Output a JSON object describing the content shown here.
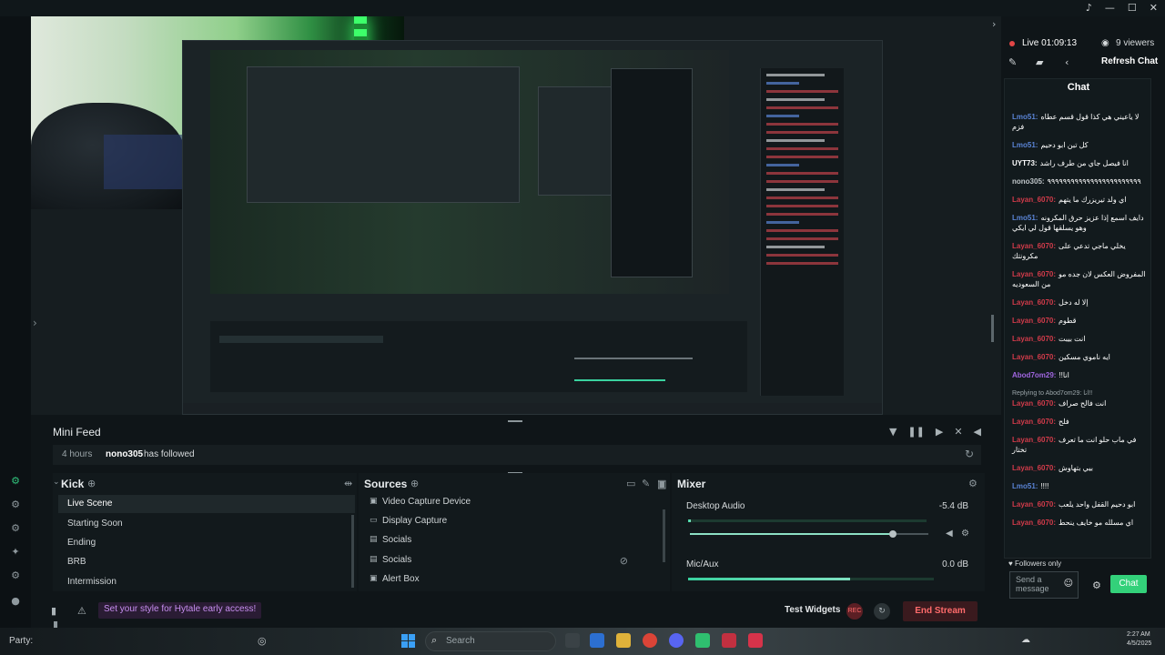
{
  "window": {
    "minimize": "—",
    "maximize": "☐",
    "close": "✕",
    "alert": "♪"
  },
  "minifeed": {
    "title": "Mini Feed",
    "event": {
      "time": "4 hours",
      "user": "nono305",
      "action": "has followed"
    }
  },
  "scenes": {
    "title": "Kick",
    "items": [
      "Live Scene",
      "Starting Soon",
      "Ending",
      "BRB",
      "Intermission"
    ],
    "active_index": 0
  },
  "sources": {
    "title": "Sources",
    "items": [
      "Video Capture Device",
      "Display Capture",
      "Socials",
      "Socials",
      "Alert Box"
    ],
    "icons": [
      "camera-icon",
      "monitor-icon",
      "folder-icon",
      "folder-icon",
      "image-icon"
    ]
  },
  "mixer": {
    "title": "Mixer",
    "channels": [
      {
        "name": "Desktop Audio",
        "db": "-5.4 dB",
        "volume": 0.85,
        "level": 0.01
      },
      {
        "name": "Mic/Aux",
        "db": "0.0 dB",
        "volume": 1.0,
        "level": 0.66
      }
    ]
  },
  "bottombar": {
    "banner": "Set your style for Hytale early access!",
    "test_widgets": "Test Widgets",
    "rec_label": "REC",
    "end_stream": "End Stream"
  },
  "rightpanel": {
    "live": "Live 01:09:13",
    "viewers": "9 viewers",
    "refresh_chat": "Refresh Chat",
    "chat_title": "Chat",
    "followers_only": "Followers only",
    "send_placeholder": "Send a message",
    "chat_button": "Chat",
    "messages": [
      {
        "user": "",
        "text": "لا ياعيني هي كذا قول قسم عطاه فزم",
        "color": "#5a84d6"
      },
      {
        "user": "Lmo51:",
        "text": "لا ياعيني هي كذا قول قسم عطاه فزم",
        "color": "#5a84d6"
      },
      {
        "user": "Lmo51:",
        "text": "كل تبن ابو دحيم",
        "color": "#5a84d6"
      },
      {
        "user": "UYT73:",
        "text": "انا فيصل جاي من طرف راشد",
        "color": "#ffffff"
      },
      {
        "user": "nono305:",
        "text": "٩٩٩٩٩٩٩٩٩٩٩٩٩٩٩٩٩٩٩٩٩٩٩٩",
        "color": "#bfc5c8"
      },
      {
        "user": "Layan_6070:",
        "text": "اي ولد تيريزرك ما يتهم",
        "color": "#d13b4a"
      },
      {
        "user": "Lmo51:",
        "text": "دايف اسمع إذا عزيز حرق المكرونه وهو يسلقها قول لي ايكي",
        "color": "#5a84d6"
      },
      {
        "user": "Layan_6070:",
        "text": "يخلي ماجي تدعي على مكرونتك",
        "color": "#d13b4a"
      },
      {
        "user": "Layan_6070:",
        "text": "المفروض العكس لان جده مو من السعوديه",
        "color": "#d13b4a"
      },
      {
        "user": "Layan_6070:",
        "text": "إلا له دخل",
        "color": "#d13b4a"
      },
      {
        "user": "Layan_6070:",
        "text": "قطوم",
        "color": "#d13b4a"
      },
      {
        "user": "Layan_6070:",
        "text": "انت بيبت",
        "color": "#d13b4a"
      },
      {
        "user": "Layan_6070:",
        "text": "ايه ناموي مسكين",
        "color": "#d13b4a"
      },
      {
        "user": "Abod7om29:",
        "text": "!!انا",
        "color": "#a066e0"
      },
      {
        "user": "Layan_6070:",
        "reply": "Replying to Abod7om29: انا!!",
        "text": "انت فالح صراف",
        "color": "#d13b4a"
      },
      {
        "user": "Layan_6070:",
        "text": "فلح",
        "color": "#d13b4a"
      },
      {
        "user": "Layan_6070:",
        "text": "في ماب حلو انت ما تعرف تختار",
        "color": "#d13b4a"
      },
      {
        "user": "Layan_6070:",
        "text": "بيي بتهاوش",
        "color": "#d13b4a"
      },
      {
        "user": "Lmo51:",
        "text": "!!!!",
        "color": "#5a84d6"
      },
      {
        "user": "Layan_6070:",
        "text": "ابو دحيم القفل واحد يلعب",
        "color": "#d13b4a"
      },
      {
        "user": "Layan_6070:",
        "text": "اي مسلله مو خايف ينحط",
        "color": "#d13b4a"
      }
    ]
  },
  "taskbar": {
    "party": "Party:",
    "search": "Search",
    "clock_time": "2:27 AM",
    "clock_date": "4/5/2025"
  },
  "colors": {
    "accent": "#33d17a",
    "live": "#e24646",
    "danger": "#ff6b6b",
    "kick_purple": "#c78ef0"
  }
}
